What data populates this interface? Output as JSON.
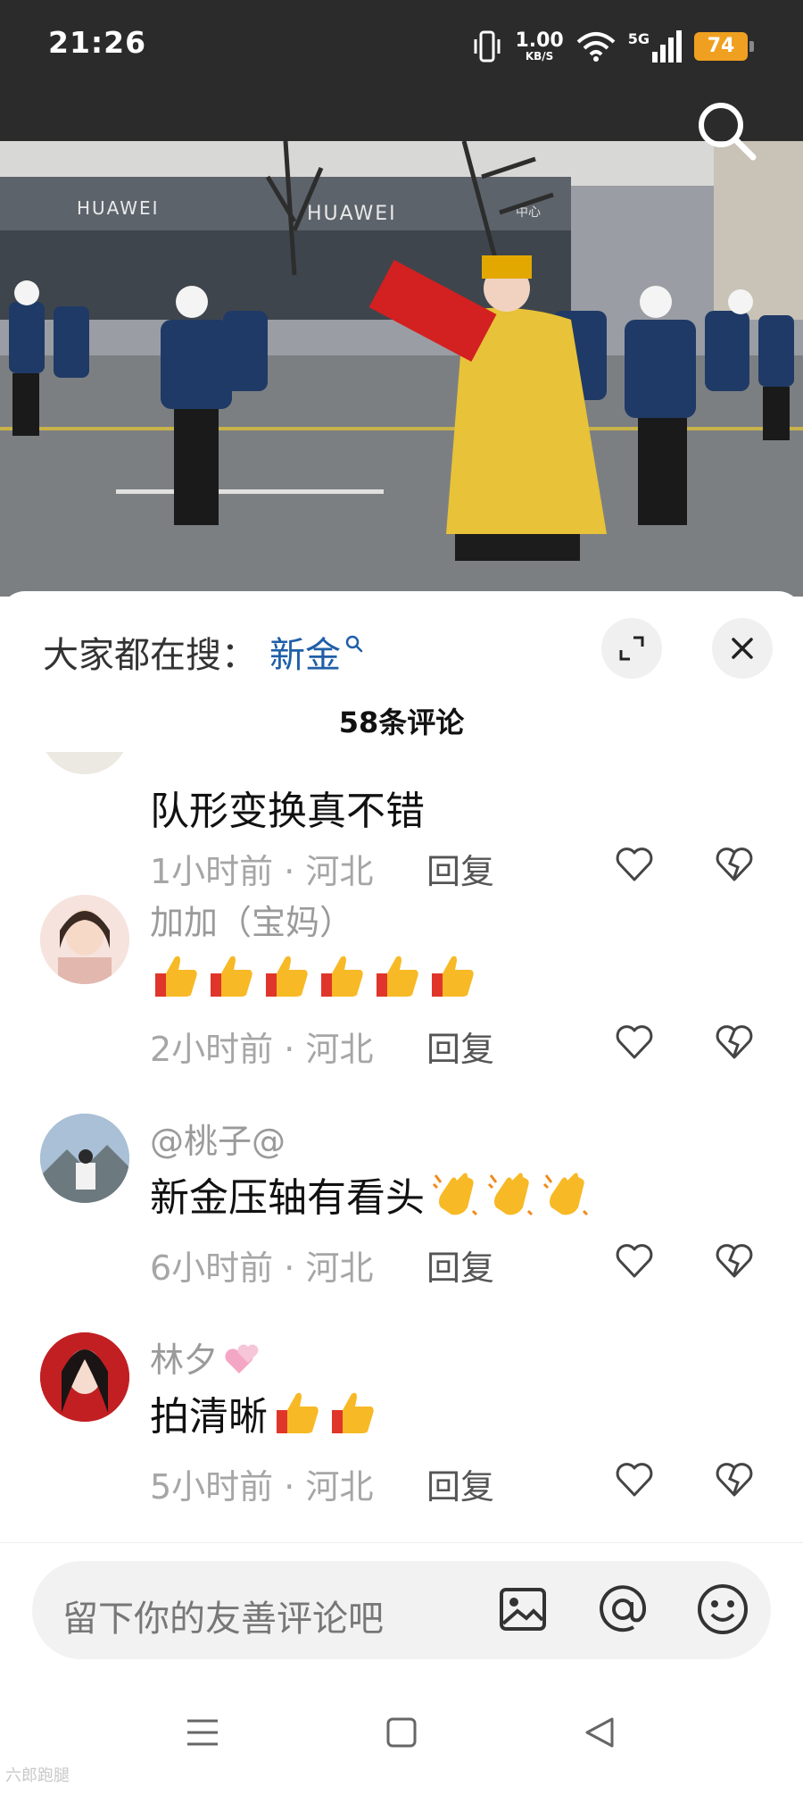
{
  "status_bar": {
    "time": "21:26",
    "net_speed_value": "1.00",
    "net_speed_unit": "KB/S",
    "network": "5G",
    "battery": "74"
  },
  "video": {
    "sign_left": "HUAWEI",
    "sign_right": "HUAWEI",
    "sign_small": "中心"
  },
  "sheet": {
    "hot_search_label": "大家都在搜：",
    "hot_search_word": "新金",
    "comment_count": "58条评论"
  },
  "comments": [
    {
      "name": "",
      "text": "队形变换真不错",
      "emojis": [],
      "time": "1小时前",
      "location": "河北",
      "reply": "回复"
    },
    {
      "name": "加加（宝妈）",
      "text": "",
      "emojis": [
        "thumbs-up",
        "thumbs-up",
        "thumbs-up",
        "thumbs-up",
        "thumbs-up",
        "thumbs-up"
      ],
      "time": "2小时前",
      "location": "河北",
      "reply": "回复"
    },
    {
      "name": "@桃子@",
      "text": "新金压轴有看头",
      "emojis": [
        "clapping-hands",
        "clapping-hands",
        "clapping-hands"
      ],
      "time": "6小时前",
      "location": "河北",
      "reply": "回复"
    },
    {
      "name": "林夕",
      "text": "拍清晰",
      "emojis": [
        "thumbs-up",
        "thumbs-up"
      ],
      "time": "5小时前",
      "location": "河北",
      "reply": "回复"
    }
  ],
  "meta_separator": " · ",
  "input": {
    "placeholder": "留下你的友善评论吧"
  },
  "watermark": "六郎跑腿",
  "icons": [
    "search-icon",
    "expand-icon",
    "close-icon",
    "heart-icon",
    "broken-heart-icon",
    "image-icon",
    "at-icon",
    "emoji-icon",
    "menu-icon",
    "home-icon",
    "back-icon"
  ]
}
